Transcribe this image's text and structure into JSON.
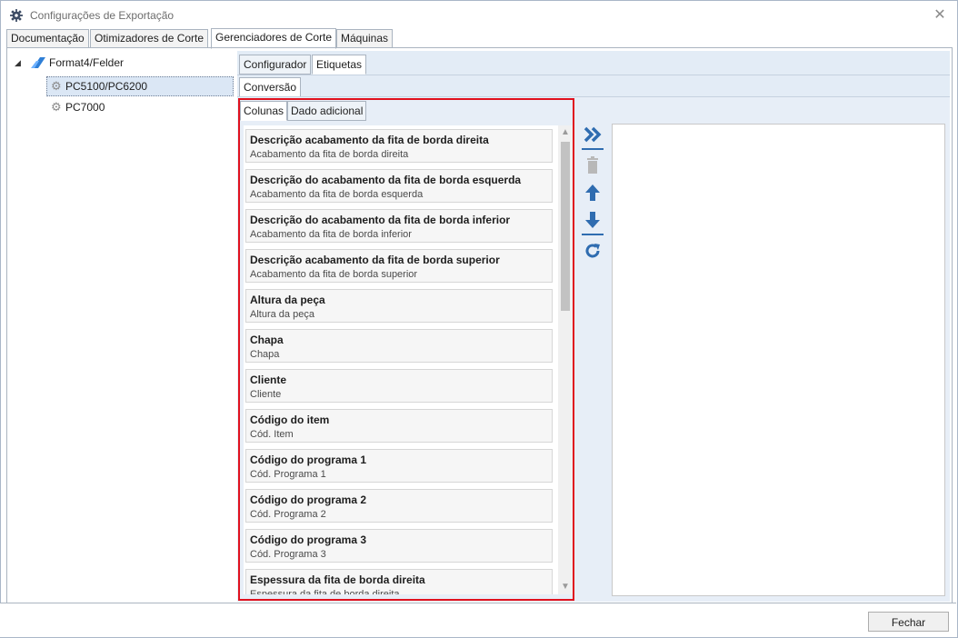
{
  "window": {
    "title": "Configurações de Exportação"
  },
  "top_tabs": [
    "Documentação",
    "Otimizadores de Corte",
    "Gerenciadores de Corte",
    "Máquinas"
  ],
  "tree": {
    "root": "Format4/Felder",
    "children": [
      "PC5100/PC6200",
      "PC7000"
    ]
  },
  "sub_tabs": [
    "Configurador",
    "Etiquetas"
  ],
  "level2_tab": "Conversão",
  "panel_tabs": [
    "Colunas",
    "Dado adicional"
  ],
  "columns": [
    {
      "title": "Descrição acabamento da fita de borda direita",
      "subtitle": "Acabamento da fita de borda direita"
    },
    {
      "title": "Descrição do acabamento da fita de borda esquerda",
      "subtitle": "Acabamento da fita de borda esquerda"
    },
    {
      "title": "Descrição do acabamento da fita de borda inferior",
      "subtitle": "Acabamento da fita de borda inferior"
    },
    {
      "title": "Descrição acabamento da fita de borda superior",
      "subtitle": "Acabamento da fita de borda superior"
    },
    {
      "title": "Altura da peça",
      "subtitle": "Altura da peça"
    },
    {
      "title": "Chapa",
      "subtitle": "Chapa"
    },
    {
      "title": "Cliente",
      "subtitle": "Cliente"
    },
    {
      "title": "Código do item",
      "subtitle": "Cód. Item"
    },
    {
      "title": "Código do programa 1",
      "subtitle": "Cód. Programa 1"
    },
    {
      "title": "Código do programa 2",
      "subtitle": "Cód. Programa 2"
    },
    {
      "title": "Código do programa 3",
      "subtitle": "Cód. Programa 3"
    },
    {
      "title": "Espessura da fita de borda direita",
      "subtitle": "Espessura da fita de borda direita"
    }
  ],
  "buttons": {
    "close": "Fechar"
  },
  "colors": {
    "highlight_border": "#e0111e",
    "accent": "#2f6cb0"
  }
}
